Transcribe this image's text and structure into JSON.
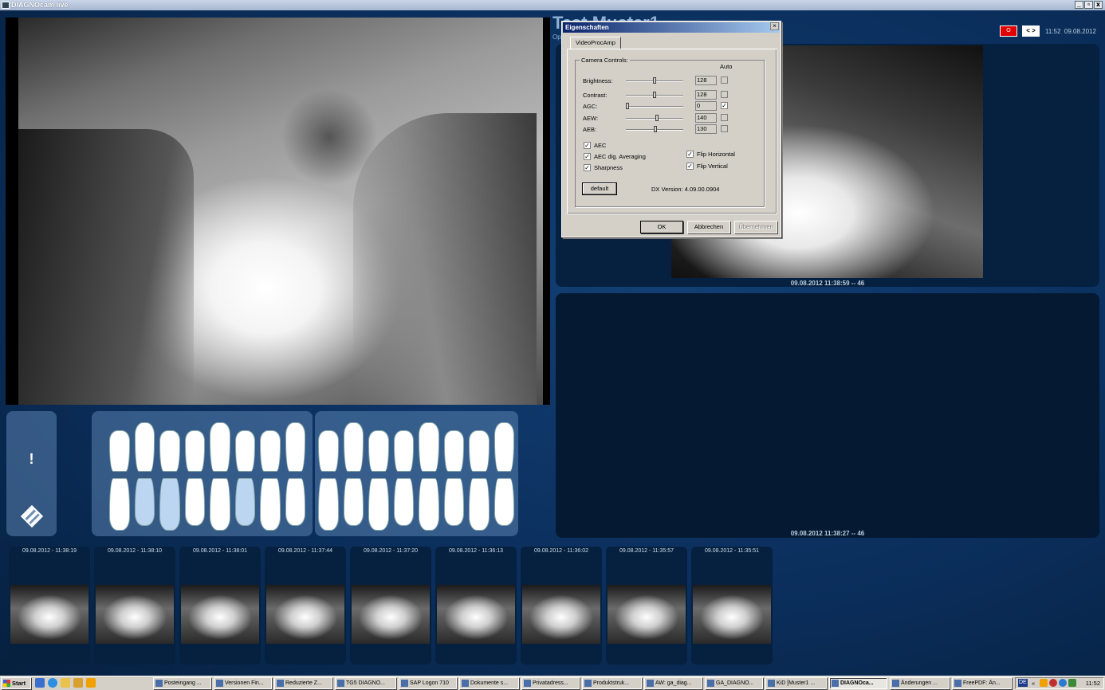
{
  "window": {
    "title": "DIAGNOcam live",
    "min": "_",
    "max": "▫",
    "close": "x"
  },
  "header": {
    "patient": "Test Muster1",
    "sub": "Op",
    "record": "O",
    "nav": "< >",
    "time": "11:52",
    "date": "09.08.2012"
  },
  "views": {
    "top_caption": "09.08.2012 11:38:59 -- 46",
    "bottom_caption": "09.08.2012 11:38:27 -- 46"
  },
  "warn": {
    "exclaim": "!"
  },
  "thumbnails": [
    "09.08.2012 - 11:38:19",
    "09.08.2012 - 11:38:10",
    "09.08.2012 - 11:38:01",
    "09.08.2012 - 11:37:44",
    "09.08.2012 - 11:37:20",
    "09.08.2012 - 11:36:13",
    "09.08.2012 - 11:36:02",
    "09.08.2012 - 11:35:57",
    "09.08.2012 - 11:35:51"
  ],
  "dialog": {
    "title": "Eigenschaften",
    "close": "×",
    "tab": "VideoProcAmp",
    "group": "Camera Controls:",
    "auto": "Auto",
    "rows": [
      {
        "label": "Brightness:",
        "value": "128",
        "level": 0.5,
        "auto": false
      },
      {
        "label": "Contrast:",
        "value": "128",
        "level": 0.5,
        "auto": false
      },
      {
        "label": "AGC:",
        "value": "0",
        "level": 0.0,
        "auto": true
      },
      {
        "label": "AEW:",
        "value": "140",
        "level": 0.55,
        "auto": false
      },
      {
        "label": "AEB:",
        "value": "130",
        "level": 0.51,
        "auto": false
      }
    ],
    "checks": {
      "aec": "AEC",
      "aec_avg": "AEC dig. Averaging",
      "sharp": "Sharpness",
      "flip_h": "Flip Horizontal",
      "flip_v": "Flip Vertical"
    },
    "default": "default",
    "dx": "DX Version: 4.09.00.0904",
    "ok": "OK",
    "cancel": "Abbrechen",
    "apply": "Übernehmen"
  },
  "taskbar": {
    "start": "Start",
    "tasks": [
      "Posteingang ...",
      "Versionen Fin...",
      "Reduzierte Z...",
      "TG5 DIAGNO...",
      "SAP Logon 710",
      "Dokumente s...",
      "Privatadress...",
      "Produktstruk...",
      "AW: ga_diag...",
      "GA_DIAGNO...",
      "KiD [Muster1 ...",
      "DIAGNOca...",
      "Änderungen ...",
      "FreePDF: Än..."
    ],
    "lang": "DE",
    "clock": "11:52"
  }
}
